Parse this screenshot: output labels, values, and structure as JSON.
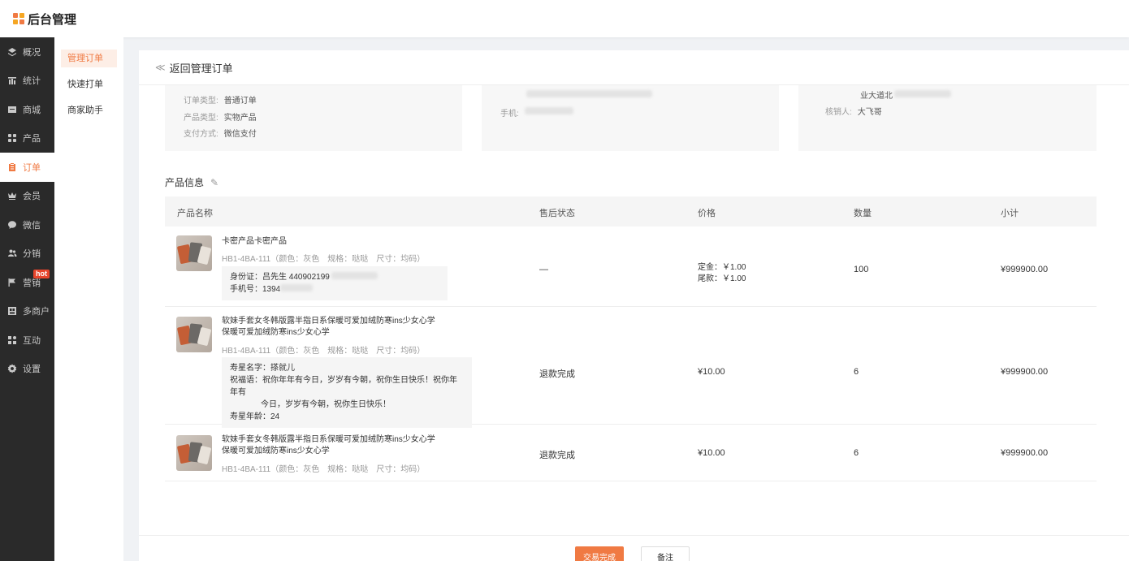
{
  "app": {
    "title": "后台管理"
  },
  "sidebar": {
    "items": [
      {
        "label": "概况",
        "icon": "layers-icon"
      },
      {
        "label": "统计",
        "icon": "chart-icon"
      },
      {
        "label": "商城",
        "icon": "store-icon"
      },
      {
        "label": "产品",
        "icon": "grid-icon"
      },
      {
        "label": "订单",
        "icon": "clipboard-icon",
        "active": true
      },
      {
        "label": "会员",
        "icon": "crown-icon"
      },
      {
        "label": "微信",
        "icon": "wechat-icon"
      },
      {
        "label": "分销",
        "icon": "users-icon"
      },
      {
        "label": "营销",
        "icon": "flag-icon",
        "badge": "hot"
      },
      {
        "label": "多商户",
        "icon": "shop-icon"
      },
      {
        "label": "互动",
        "icon": "apps-icon"
      },
      {
        "label": "设置",
        "icon": "gear-icon"
      }
    ]
  },
  "subnav": {
    "items": [
      {
        "label": "管理订单",
        "active": true
      },
      {
        "label": "快速打单"
      },
      {
        "label": "商家助手"
      }
    ]
  },
  "main": {
    "back_label": "返回管理订单",
    "card1": {
      "order_type_label": "订单类型:",
      "order_type": "普通订单",
      "product_type_label": "产品类型:",
      "product_type": "实物产品",
      "pay_label": "支付方式:",
      "pay": "微信支付"
    },
    "card2": {
      "phone_label": "手机:"
    },
    "card3": {
      "addr_partial": "业大道北",
      "verifier_label": "核销人:",
      "verifier": "大飞哥"
    },
    "section_title": "产品信息",
    "table": {
      "headers": [
        "产品名称",
        "售后状态",
        "价格",
        "数量",
        "小计"
      ],
      "rows": [
        {
          "name": "卡密产品卡密产品",
          "sku": "HB1-4BA-111（颜色：灰色　规格：哒哒　尺寸：均码）",
          "extra1": "身份证：吕先生  440902199",
          "extra2": "手机号：1394",
          "status": "—",
          "price1": "定金：￥1.00",
          "price2": "尾款：￥1.00",
          "qty": "100",
          "subtotal": "¥999900.00"
        },
        {
          "name1": "软妹手套女冬韩版露半指日系保暖可爱加绒防寒ins少女心学",
          "name2": "保暖可爱加绒防寒ins少女心学",
          "sku": "HB1-4BA-111（颜色：灰色　规格：哒哒　尺寸：均码）",
          "extra1": "寿星名字：搽就儿",
          "extra2": "祝福语：祝你年年有今日，岁岁有今朝，祝你生日快乐！祝你年年有",
          "extra3": "今日，岁岁有今朝，祝你生日快乐！",
          "extra4": "寿星年龄：24",
          "status": "退款完成",
          "price": "¥10.00",
          "qty": "6",
          "subtotal": "¥999900.00"
        },
        {
          "name1": "软妹手套女冬韩版露半指日系保暖可爱加绒防寒ins少女心学",
          "name2": "保暖可爱加绒防寒ins少女心学",
          "sku": "HB1-4BA-111（颜色：灰色　规格：哒哒　尺寸：均码）",
          "status": "退款完成",
          "price": "¥10.00",
          "qty": "6",
          "subtotal": "¥999900.00"
        }
      ]
    }
  },
  "footer": {
    "done_label": "交易完成",
    "note_label": "备注"
  },
  "colors": {
    "accent": "#f07a43",
    "sidebar_bg": "#2a2a2a",
    "hot": "#e8452c"
  }
}
